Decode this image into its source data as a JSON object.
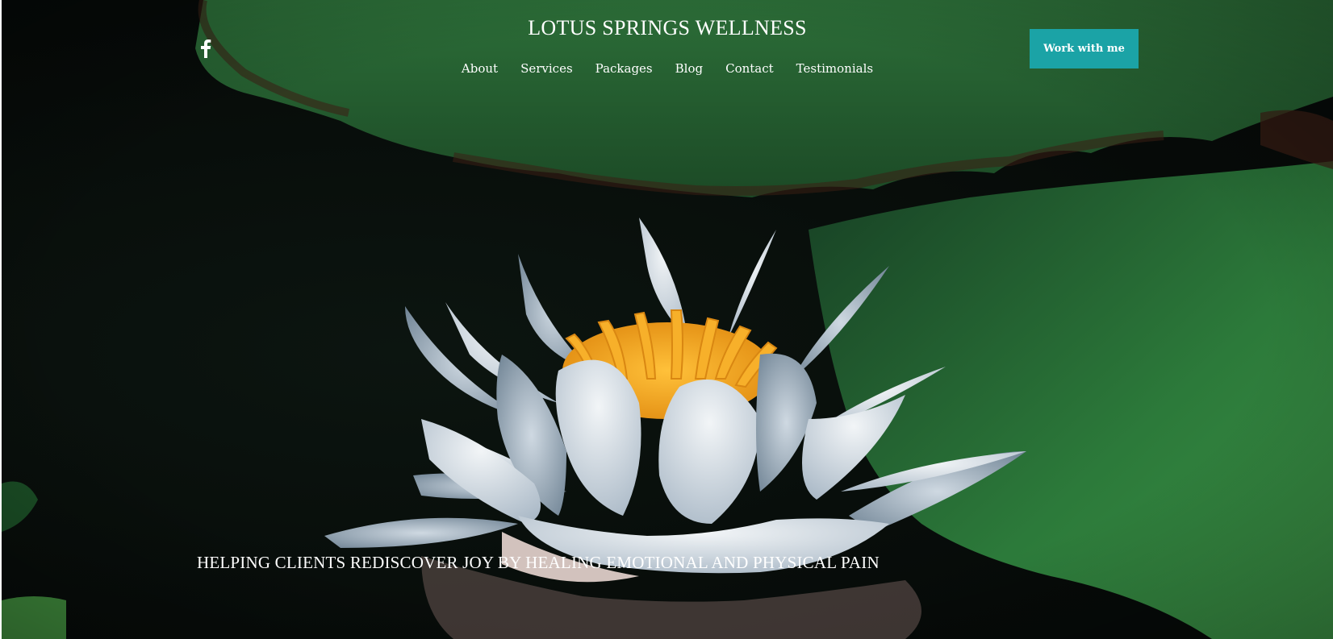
{
  "header": {
    "site_title": "LOTUS SPRINGS WELLNESS",
    "social_icon": "facebook-icon",
    "nav": [
      {
        "label": "About"
      },
      {
        "label": "Services"
      },
      {
        "label": "Packages"
      },
      {
        "label": "Blog"
      },
      {
        "label": "Contact"
      },
      {
        "label": "Testimonials"
      }
    ],
    "cta_label": "Work with me"
  },
  "hero": {
    "background_image": "white-lotus-on-lily-pads",
    "tagline": "HELPING CLIENTS REDISCOVER JOY BY HEALING EMOTIONAL AND PHYSICAL PAIN"
  },
  "colors": {
    "accent": "#1ba3a6",
    "text": "#ffffff",
    "lily_pad": "#2f7a3c",
    "water": "#060a08",
    "petal": "#dfe6ec",
    "stamen": "#f4a51c"
  }
}
